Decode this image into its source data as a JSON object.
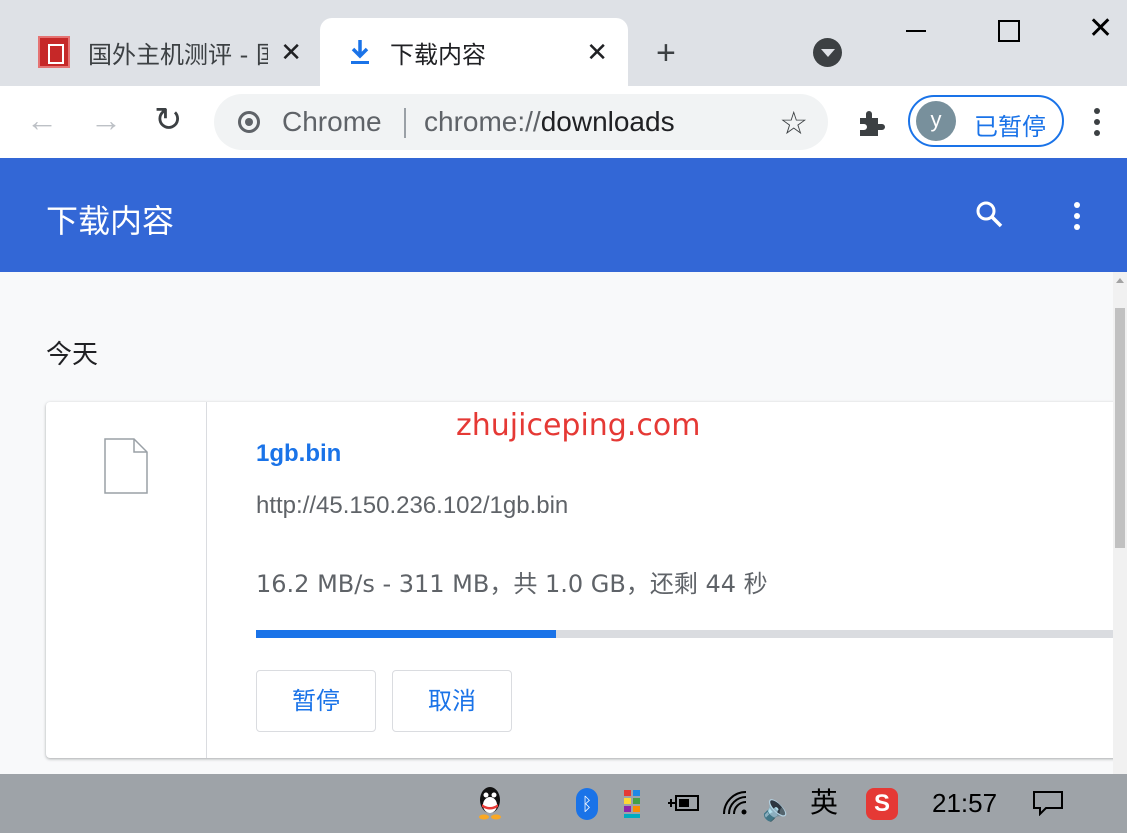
{
  "tabs": [
    {
      "title": "国外主机测评 - 国",
      "active": false,
      "favicon": "site-seal-icon"
    },
    {
      "title": "下载内容",
      "active": true,
      "favicon": "download-icon"
    }
  ],
  "toolbar": {
    "omnibox_chip": "Chrome",
    "url_scheme": "chrome://",
    "url_host": "downloads",
    "profile_initial": "y",
    "profile_label": "已暂停"
  },
  "page": {
    "title": "下载内容",
    "date_header": "今天"
  },
  "download": {
    "file_name": "1gb.bin",
    "url": "http://45.150.236.102/1gb.bin",
    "status": "16.2 MB/s - 311 MB，共 1.0 GB，还剩 44 秒",
    "progress_fraction": 0.3413,
    "pause_label": "暂停",
    "cancel_label": "取消"
  },
  "watermark": "zhujiceping.com",
  "taskbar": {
    "ime": "英",
    "sogou": "S",
    "clock": "21:57"
  },
  "colors": {
    "accent": "#1a73e8",
    "appbar": "#3367d6",
    "watermark": "#e53935"
  }
}
